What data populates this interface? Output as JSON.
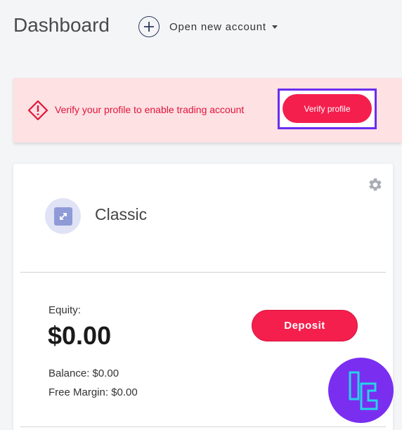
{
  "header": {
    "title": "Dashboard",
    "open_account_label": "Open new account"
  },
  "alert": {
    "message": "Verify your profile to enable trading account",
    "button_label": "Verify profile",
    "color": "#e3143a",
    "background": "#fde1e3"
  },
  "account": {
    "name": "Classic",
    "equity_label": "Equity:",
    "equity_value": "$0.00",
    "balance": "Balance: $0.00",
    "free_margin": "Free Margin: $0.00",
    "deposit_label": "Deposit",
    "accent": "#f41f4d"
  },
  "icons": {
    "add": "plus-circle-icon",
    "alert": "warning-diamond-icon",
    "settings": "gear-icon",
    "account": "expand-arrows-icon",
    "watermark": "logo-icon"
  }
}
